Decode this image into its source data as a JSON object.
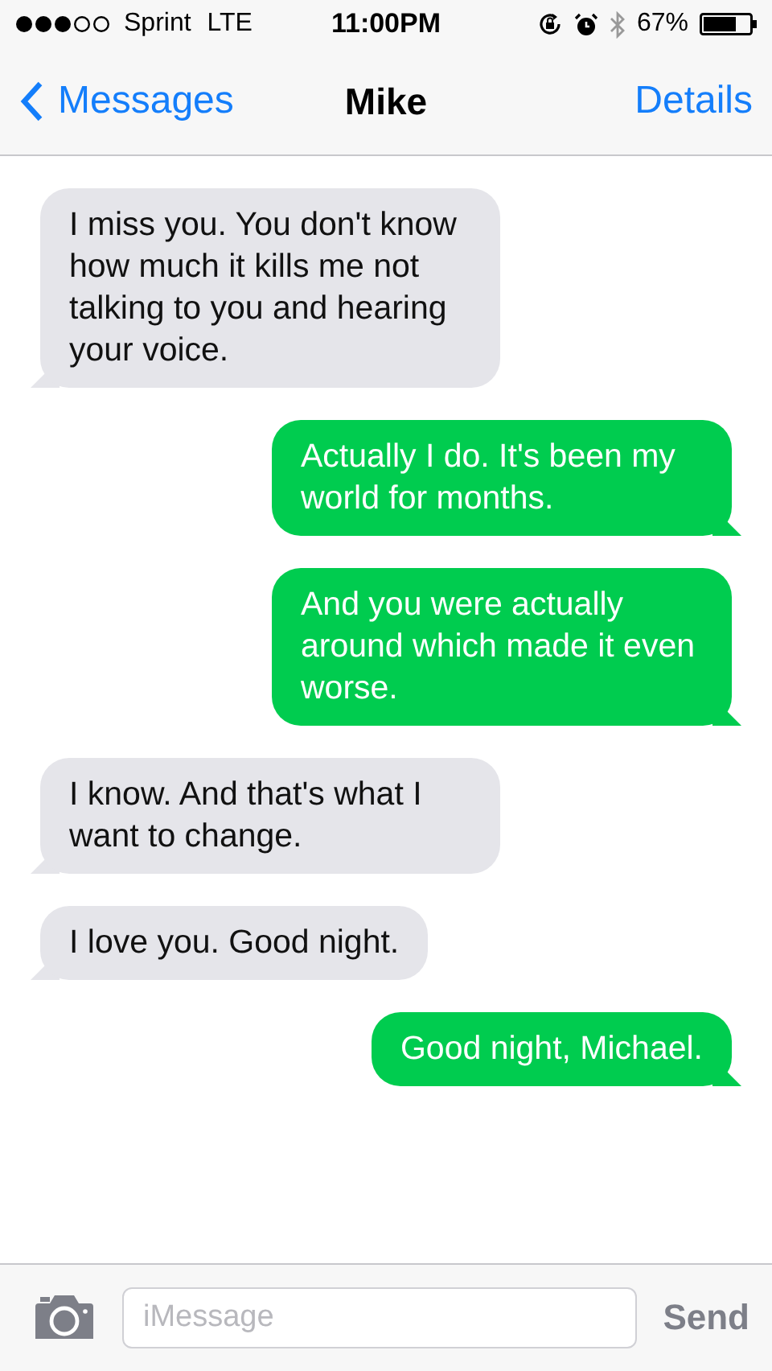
{
  "status_bar": {
    "carrier": "Sprint",
    "network": "LTE",
    "time": "11:00PM",
    "battery": "67%"
  },
  "nav": {
    "back": "Messages",
    "title": "Mike",
    "action": "Details"
  },
  "messages": [
    {
      "kind": "received",
      "text": "I miss you. You don't know how much it kills me not talking to you and hearing your voice."
    },
    {
      "kind": "sent",
      "text": "Actually I do. It's been my world for months."
    },
    {
      "kind": "sent",
      "text": "And you were actually around which made it even worse."
    },
    {
      "kind": "received",
      "text": "I know. And that's what I want to change."
    },
    {
      "kind": "received",
      "text": "I love you. Good night."
    },
    {
      "kind": "sent",
      "text": "Good night, Michael."
    }
  ],
  "composer": {
    "placeholder": "iMessage",
    "send": "Send"
  }
}
